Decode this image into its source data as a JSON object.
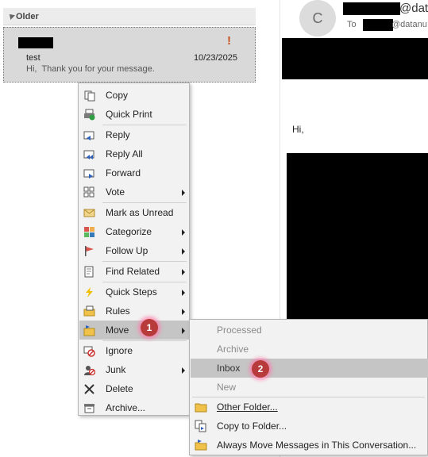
{
  "message_list": {
    "group_header": "Older",
    "item": {
      "subject": "test",
      "preview": "Hi,  Thank you for your message.",
      "date": "10/23/2025",
      "importance": "!"
    }
  },
  "reading_pane": {
    "avatar_initial": "C",
    "from_domain_fragment": "@data",
    "to_label": "To",
    "to_domain_fragment": "@datanu",
    "greeting": "Hi,"
  },
  "context_menu": {
    "items": [
      {
        "label": "Copy",
        "icon": "copy-icon",
        "submenu": false
      },
      {
        "label": "Quick Print",
        "icon": "quick-print-icon",
        "submenu": false
      },
      {
        "label": "Reply",
        "icon": "reply-icon",
        "submenu": false
      },
      {
        "label": "Reply All",
        "icon": "reply-all-icon",
        "submenu": false
      },
      {
        "label": "Forward",
        "icon": "forward-icon",
        "submenu": false
      },
      {
        "label": "Vote",
        "icon": "vote-icon",
        "submenu": true
      },
      {
        "label": "Mark as Unread",
        "icon": "envelope-icon",
        "submenu": false
      },
      {
        "label": "Categorize",
        "icon": "categorize-icon",
        "submenu": true
      },
      {
        "label": "Follow Up",
        "icon": "flag-icon",
        "submenu": true
      },
      {
        "label": "Find Related",
        "icon": "find-related-icon",
        "submenu": true
      },
      {
        "label": "Quick Steps",
        "icon": "lightning-icon",
        "submenu": true
      },
      {
        "label": "Rules",
        "icon": "rules-icon",
        "submenu": true
      },
      {
        "label": "Move",
        "icon": "move-folder-icon",
        "submenu": true
      },
      {
        "label": "Ignore",
        "icon": "ignore-icon",
        "submenu": false
      },
      {
        "label": "Junk",
        "icon": "junk-icon",
        "submenu": true
      },
      {
        "label": "Delete",
        "icon": "delete-icon",
        "submenu": false
      },
      {
        "label": "Archive...",
        "icon": "archive-icon",
        "submenu": false
      }
    ],
    "highlighted": "Move"
  },
  "move_submenu": {
    "items": [
      {
        "label": "Processed",
        "disabled": true
      },
      {
        "label": "Archive",
        "disabled": true
      },
      {
        "label": "Inbox",
        "disabled": false
      },
      {
        "label": "New",
        "disabled": true
      },
      {
        "label": "Other Folder...",
        "icon": "folder-icon"
      },
      {
        "label": "Copy to Folder...",
        "icon": "copy-to-folder-icon"
      },
      {
        "label": "Always Move Messages in This Conversation...",
        "icon": "always-move-icon"
      }
    ],
    "highlighted": "Inbox"
  },
  "step_badges": [
    "1",
    "2"
  ],
  "colors": {
    "menu_background": "#f2f2f2",
    "menu_highlight": "#c5c5c5",
    "badge": "#b83b3b",
    "importance": "#c8501e"
  }
}
